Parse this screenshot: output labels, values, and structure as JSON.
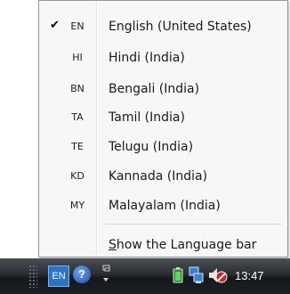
{
  "menu": {
    "items": [
      {
        "code": "EN",
        "label": "English (United States)",
        "checked": true
      },
      {
        "code": "HI",
        "label": "Hindi (India)",
        "checked": false
      },
      {
        "code": "BN",
        "label": "Bengali (India)",
        "checked": false
      },
      {
        "code": "TA",
        "label": "Tamil (India)",
        "checked": false
      },
      {
        "code": "TE",
        "label": "Telugu (India)",
        "checked": false
      },
      {
        "code": "KD",
        "label": "Kannada (India)",
        "checked": false
      },
      {
        "code": "MY",
        "label": "Malayalam (India)",
        "checked": false
      }
    ],
    "check_glyph": "✔",
    "show_bar": {
      "label_mnemonic": "S",
      "label_rest": "how the Language bar"
    }
  },
  "taskbar": {
    "lang_button": "EN",
    "help_glyph": "?",
    "clock": "13:47",
    "icons": [
      "grip-icon",
      "help-icon",
      "options-icon",
      "battery-icon",
      "network-icon",
      "volume-muted-icon"
    ],
    "colors": {
      "lang_button_bg": "#2a74c5",
      "mute_red": "#d81e1e"
    }
  }
}
